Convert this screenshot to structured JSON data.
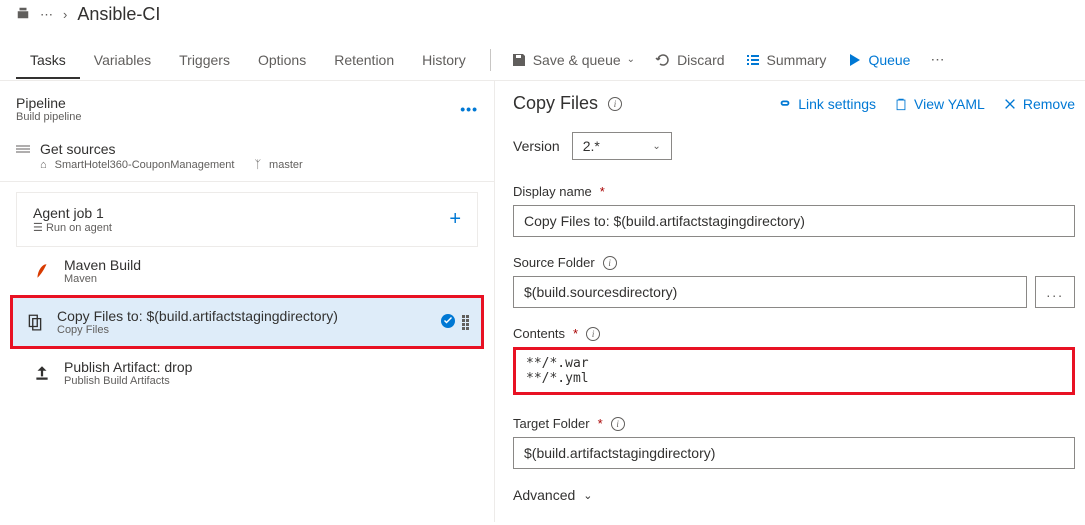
{
  "breadcrumb": {
    "title": "Ansible-CI"
  },
  "tabs": [
    "Tasks",
    "Variables",
    "Triggers",
    "Options",
    "Retention",
    "History"
  ],
  "toolbar": {
    "save_queue": "Save & queue",
    "discard": "Discard",
    "summary": "Summary",
    "queue": "Queue"
  },
  "pipeline": {
    "name": "Pipeline",
    "sub": "Build pipeline",
    "get_sources": "Get sources",
    "repo": "SmartHotel360-CouponManagement",
    "branch": "master",
    "agent_job": "Agent job 1",
    "agent_sub": "Run on agent",
    "tasks": [
      {
        "title": "Maven Build",
        "sub": "Maven"
      },
      {
        "title": "Copy Files to: $(build.artifactstagingdirectory)",
        "sub": "Copy Files"
      },
      {
        "title": "Publish Artifact: drop",
        "sub": "Publish Build Artifacts"
      }
    ]
  },
  "details": {
    "title": "Copy Files",
    "link_settings": "Link settings",
    "view_yaml": "View YAML",
    "remove": "Remove",
    "version_label": "Version",
    "version_value": "2.*",
    "display_name_label": "Display name",
    "display_name_value": "Copy Files to: $(build.artifactstagingdirectory)",
    "source_folder_label": "Source Folder",
    "source_folder_value": "$(build.sourcesdirectory)",
    "contents_label": "Contents",
    "contents_value": "**/*.war\n**/*.yml",
    "target_folder_label": "Target Folder",
    "target_folder_value": "$(build.artifactstagingdirectory)",
    "advanced": "Advanced"
  }
}
